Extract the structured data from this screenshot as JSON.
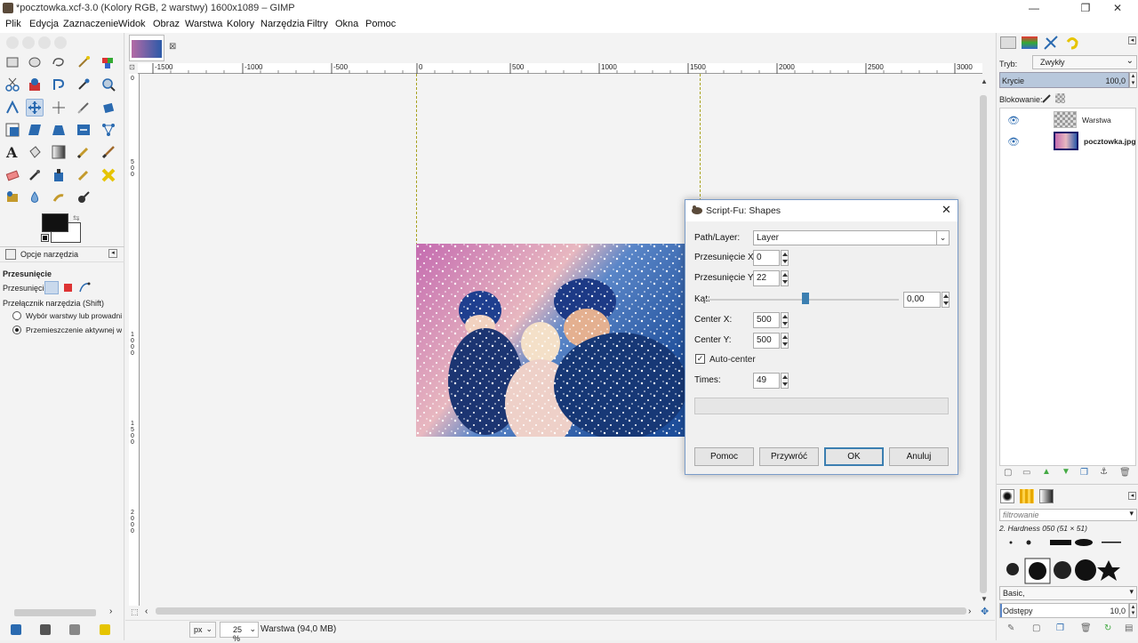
{
  "window": {
    "title": "*pocztowka.xcf-3.0 (Kolory RGB, 2 warstwy) 1600x1089 – GIMP",
    "minimize": "—",
    "maximize": "❐",
    "close": "✕"
  },
  "menu": [
    "Plik",
    "Edycja",
    "Zaznaczenie",
    "Widok",
    "Obraz",
    "Warstwa",
    "Kolory",
    "Narzędzia",
    "Filtry",
    "Okna",
    "Pomoc"
  ],
  "tool_options": {
    "tab_label": "Opcje narzędzia",
    "tool_name": "Przesunięcie",
    "move_label": "Przesunięcie:",
    "toggle_label": "Przełącznik narzędzia  (Shift)",
    "radio1": "Wybór warstwy lub prowadnic",
    "radio2": "Przemieszczenie aktywnej war"
  },
  "ruler": {
    "top_ticks": [
      "-1500",
      "-1000",
      "-500",
      "0",
      "500",
      "1000",
      "1500",
      "2000",
      "2500",
      "3000"
    ],
    "left_ticks": [
      "0",
      "5 0 0",
      "1 0 0 0",
      "1 5 0 0",
      "2 0 0 0"
    ]
  },
  "statusbar": {
    "unit": "px",
    "zoom": "25 %",
    "info": "Warstwa (94,0 MB)"
  },
  "layers_panel": {
    "mode_label": "Tryb:",
    "mode_value": "Zwykły",
    "opacity_label": "Krycie",
    "opacity_value": "100,0",
    "lock_label": "Blokowanie:",
    "layers": [
      {
        "name": "Warstwa"
      },
      {
        "name": "pocztowka.jpg"
      }
    ]
  },
  "brushes_panel": {
    "filter_placeholder": "filtrowanie",
    "brush_name": "2. Hardness 050 (51 × 51)",
    "preset": "Basic,",
    "spacing_label": "Odstępy",
    "spacing_value": "10,0"
  },
  "dialog": {
    "title": "Script-Fu: Shapes",
    "path_label": "Path/Layer:",
    "path_value": "Layer",
    "offset_x_label": "Przesunięcie X:",
    "offset_x": "0",
    "offset_y_label": "Przesunięcie Y:",
    "offset_y": "22",
    "angle_label": "Kąt:",
    "angle_value": "0,00",
    "angle_fraction": 0.52,
    "center_x_label": "Center X:",
    "center_x": "500",
    "center_y_label": "Center Y:",
    "center_y": "500",
    "autocenter_label": "Auto-center",
    "autocenter_checked": true,
    "times_label": "Times:",
    "times": "49",
    "buttons": {
      "help": "Pomoc",
      "reset": "Przywróć",
      "ok": "OK",
      "cancel": "Anuluj"
    }
  },
  "colors": {
    "accent": "#3c7fb1",
    "foreground": "#111111",
    "background": "#ffffff"
  }
}
